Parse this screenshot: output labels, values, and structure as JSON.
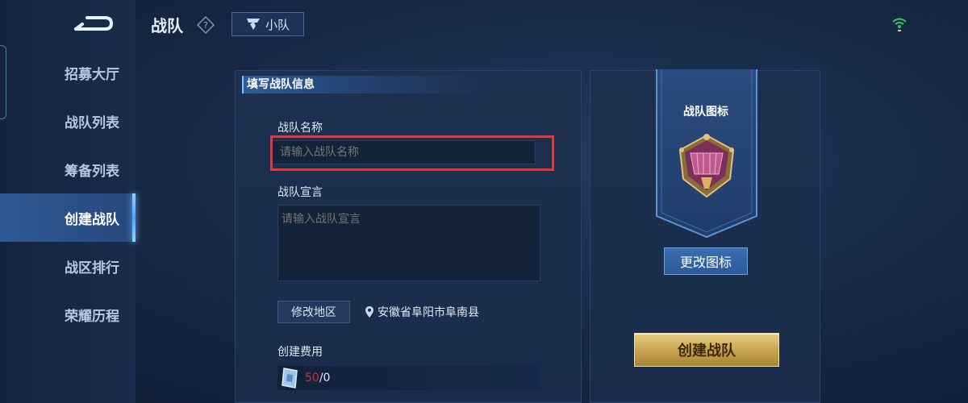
{
  "sidebar": {
    "items": [
      {
        "label": "招募大厅",
        "active": false
      },
      {
        "label": "战队列表",
        "active": false
      },
      {
        "label": "筹备列表",
        "active": false
      },
      {
        "label": "创建战队",
        "active": true
      },
      {
        "label": "战区排行",
        "active": false
      },
      {
        "label": "荣耀历程",
        "active": false
      }
    ]
  },
  "header": {
    "title": "战队",
    "squad_tab_label": "小队"
  },
  "form": {
    "heading": "填写战队信息",
    "name_label": "战队名称",
    "name_placeholder": "请输入战队名称",
    "slogan_label": "战队宣言",
    "slogan_placeholder": "请输入战队宣言",
    "change_region_label": "修改地区",
    "location": "安徽省阜阳市阜南县",
    "cost_label": "创建费用",
    "cost_current": "50",
    "cost_owned": "/0"
  },
  "icon_panel": {
    "title": "战队图标",
    "change_icon_label": "更改图标",
    "create_button_label": "创建战队"
  },
  "colors": {
    "accent_blue": "#4ea6ff",
    "highlight_red": "#e0393b",
    "gold": "#c9a552",
    "cost_red": "#c53434"
  }
}
